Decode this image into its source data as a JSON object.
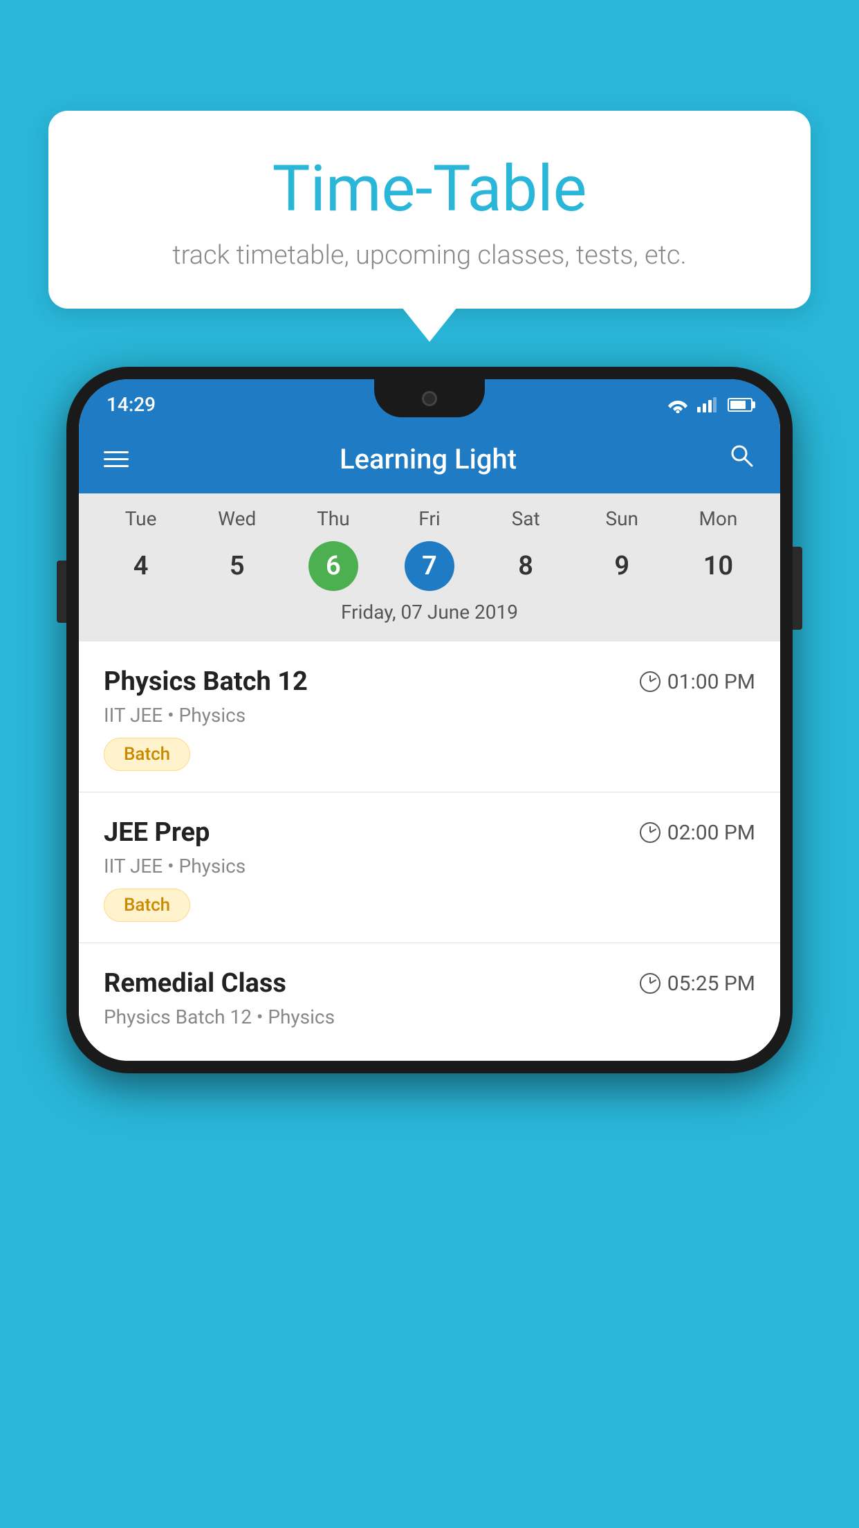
{
  "background_color": "#29B6D8",
  "bubble": {
    "title": "Time-Table",
    "subtitle": "track timetable, upcoming classes, tests, etc."
  },
  "status_bar": {
    "time": "14:29"
  },
  "app_bar": {
    "title": "Learning Light"
  },
  "calendar": {
    "weekdays": [
      "Tue",
      "Wed",
      "Thu",
      "Fri",
      "Sat",
      "Sun",
      "Mon"
    ],
    "dates": [
      {
        "day": "4",
        "state": "normal"
      },
      {
        "day": "5",
        "state": "normal"
      },
      {
        "day": "6",
        "state": "today"
      },
      {
        "day": "7",
        "state": "selected"
      },
      {
        "day": "8",
        "state": "normal"
      },
      {
        "day": "9",
        "state": "normal"
      },
      {
        "day": "10",
        "state": "normal"
      }
    ],
    "selected_date_label": "Friday, 07 June 2019"
  },
  "schedule": [
    {
      "title": "Physics Batch 12",
      "time": "01:00 PM",
      "subtitle": "IIT JEE • Physics",
      "tag": "Batch"
    },
    {
      "title": "JEE Prep",
      "time": "02:00 PM",
      "subtitle": "IIT JEE • Physics",
      "tag": "Batch"
    },
    {
      "title": "Remedial Class",
      "time": "05:25 PM",
      "subtitle": "Physics Batch 12 • Physics",
      "tag": ""
    }
  ]
}
